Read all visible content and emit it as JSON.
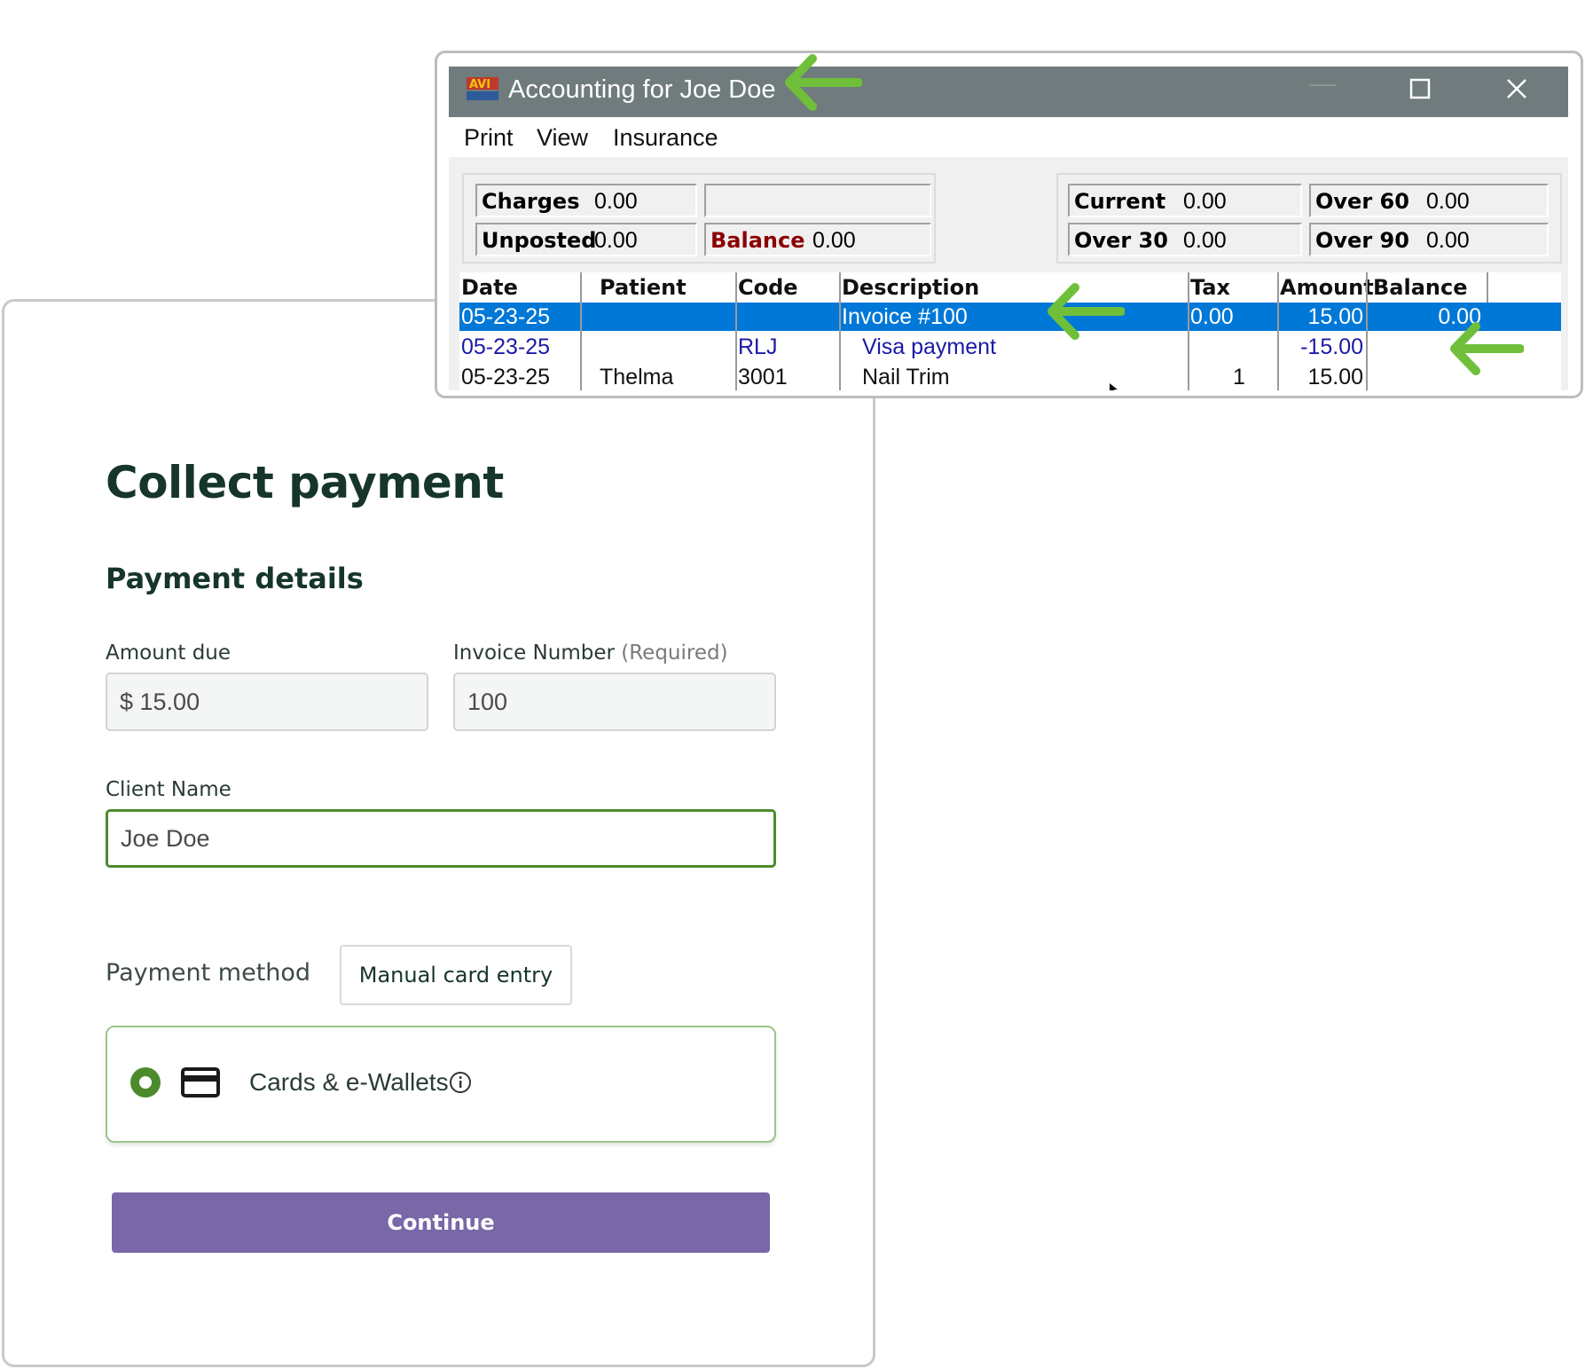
{
  "payment": {
    "title": "Collect payment",
    "subtitle": "Payment details",
    "amount_label": "Amount due",
    "amount_value": "$ 15.00",
    "invoice_label": "Invoice Number",
    "invoice_required": "(Required)",
    "invoice_value": "100",
    "client_label": "Client Name",
    "client_value": "Joe Doe",
    "method_label": "Payment method",
    "manual_button": "Manual card entry",
    "option_label": "Cards & e-Wallets",
    "option_selected": true,
    "continue_button": "Continue"
  },
  "accounting": {
    "window_title": "Accounting for Joe Doe",
    "menu": [
      "Print",
      "View",
      "Insurance"
    ],
    "summary": {
      "charges_label": "Charges",
      "charges_value": "0.00",
      "unposted_label": "Unposted",
      "unposted_value": "0.00",
      "balance_label": "Balance",
      "balance_value": "0.00",
      "current_label": "Current",
      "current_value": "0.00",
      "over30_label": "Over 30",
      "over30_value": "0.00",
      "over60_label": "Over 60",
      "over60_value": "0.00",
      "over90_label": "Over 90",
      "over90_value": "0.00"
    },
    "columns": [
      "Date",
      "Patient",
      "Code",
      "Description",
      "Tax",
      "Amount",
      "Balance"
    ],
    "rows": [
      {
        "date": "05-23-25",
        "patient": "",
        "code": "",
        "description": "Invoice #100",
        "tax": "0.00",
        "amount": "15.00",
        "balance": "0.00",
        "selected": true
      },
      {
        "date": "05-23-25",
        "patient": "",
        "code": "RLJ",
        "description": "Visa payment",
        "tax": "",
        "amount": "-15.00",
        "balance": ""
      },
      {
        "date": "05-23-25",
        "patient": "Thelma",
        "code": "3001",
        "description": "Nail Trim",
        "tax": "1",
        "amount": "15.00",
        "balance": ""
      }
    ]
  },
  "colors": {
    "annotation_arrow": "#6fbf3a",
    "selection": "#0078d7",
    "continue_button": "#7a67a8",
    "active_border": "#4c8b2b",
    "titlebar": "#6f7b7c"
  },
  "icons": [
    "app-logo-icon",
    "minimize-icon",
    "maximize-icon",
    "close-icon",
    "radio-selected-icon",
    "credit-card-icon",
    "info-icon",
    "annotation-arrow-icon"
  ]
}
